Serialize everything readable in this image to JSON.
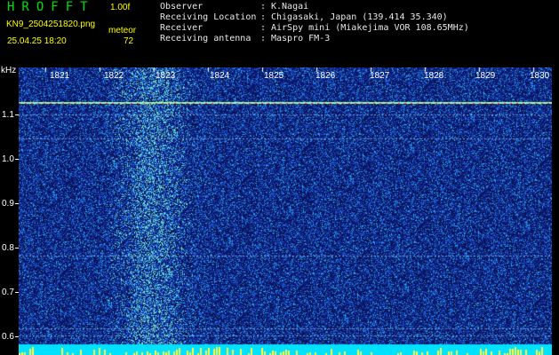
{
  "header": {
    "app_title": "HROFFT",
    "version": "1.00f",
    "filename": "KN9_2504251820.png",
    "datetime": "25.04.25 18:20",
    "source": "meteor",
    "number": "72"
  },
  "info": [
    {
      "label": "Observer",
      "sep": ":",
      "value": "K.Nagai"
    },
    {
      "label": "Receiving Location",
      "sep": ":",
      "value": "Chigasaki, Japan (139.414 35.340)"
    },
    {
      "label": "Receiver",
      "sep": ":",
      "value": "AirSpy mini (Miakejima VOR 108.65MHz)"
    },
    {
      "label": "Receiving antenna",
      "sep": ":",
      "value": "Maspro FM-3"
    }
  ],
  "axes": {
    "y_unit": "kHz",
    "y_ticks": [
      "1.1",
      "1.0",
      "0.9",
      "0.8",
      "0.7",
      "0.6"
    ],
    "x_ticks": [
      "1821",
      "1822",
      "1823",
      "1824",
      "1825",
      "1826",
      "1827",
      "1828",
      "1829",
      "1830"
    ]
  },
  "colors": {
    "background": "#000000",
    "plot_bg": "#0a1a66",
    "title_green": "#00e000",
    "meta_yellow": "#ffff00",
    "info_text": "#e8e8e8",
    "carrier_red": "#ff3030",
    "bottom_band": "#00e0ff"
  }
}
